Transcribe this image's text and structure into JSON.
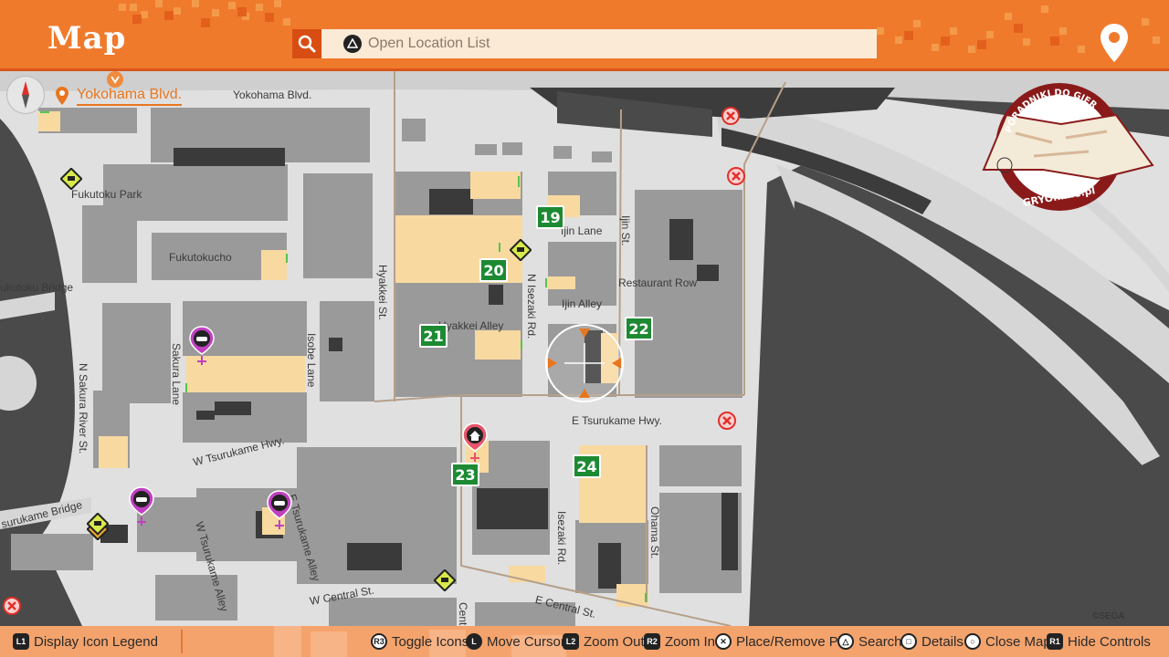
{
  "header": {
    "title": "Map",
    "search_placeholder": "Open Location List"
  },
  "current_location": "Yokohama Blvd.",
  "street_labels": [
    "Yokohama Blvd.",
    "Fukutoku Park",
    "Fukutokucho",
    "ukutoku Bridge",
    "N Sakura River St.",
    "Sakura Lane",
    "Isobe Lane",
    "Hyakkei St.",
    "Hyakkei Alley",
    "N Isezaki Rd.",
    "Ijin Lane",
    "Ijin St.",
    "Restaurant Row",
    "Ijin Alley",
    "E Tsurukame Hwy.",
    "W Tsurukame Hwy.",
    "surukame Bridge",
    "W Tsurukame Alley",
    "E Tsurukame Alley",
    "W Central St.",
    "Isezaki Rd.",
    "Ohama St.",
    "E Central St.",
    "Centr"
  ],
  "location_numbers": [
    "19",
    "20",
    "21",
    "22",
    "23",
    "24"
  ],
  "watermark": {
    "top_text": "PORADNIKI DO GIER",
    "bottom_text": "GRYOnline.pl"
  },
  "copyright": "©SEGA",
  "controls": {
    "legend": {
      "key": "L1",
      "label": "Display Icon Legend"
    },
    "toggle_icons": {
      "key": "R3",
      "label": "Toggle Icons"
    },
    "move_cursor": {
      "key": "L",
      "label": "Move Cursor"
    },
    "zoom_out": {
      "key": "L2",
      "label": "Zoom Out"
    },
    "zoom_in": {
      "key": "R2",
      "label": "Zoom In"
    },
    "place_pin": {
      "key": "✕",
      "label": "Place/Remove Pin"
    },
    "search": {
      "key": "△",
      "label": "Search"
    },
    "details": {
      "key": "□",
      "label": "Details"
    },
    "close_map": {
      "key": "○",
      "label": "Close Map"
    },
    "hide_controls": {
      "key": "R1",
      "label": "Hide Controls"
    }
  },
  "colors": {
    "header": "#f07a2c",
    "road": "#e2e2e2",
    "building": "#9a9a9a",
    "highlight": "#f8d9a0",
    "water": "#4a4a4a",
    "marker_green": "#1d8a33",
    "accent_orange": "#e8761f"
  },
  "icons": [
    "search-icon",
    "map-pin-icon",
    "compass-icon",
    "gamepad-icon",
    "home-icon",
    "chat-icon",
    "no-entry-icon",
    "cursor-reticle-icon"
  ]
}
